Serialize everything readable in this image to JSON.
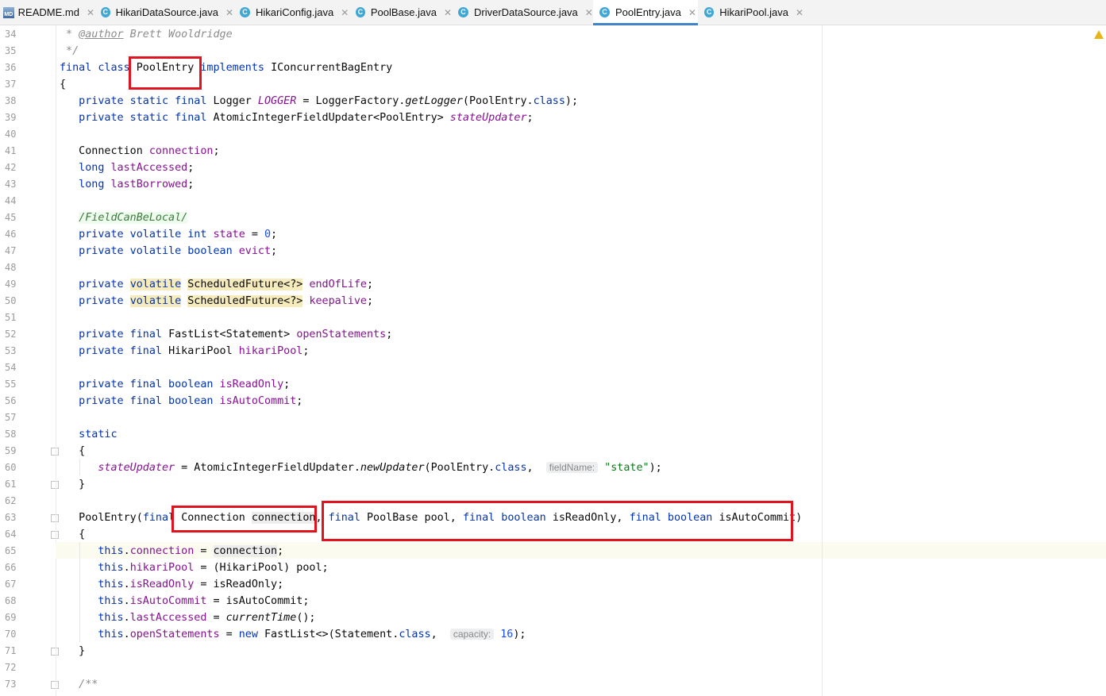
{
  "tabs": [
    {
      "label": "README.md",
      "icon": "markdown-file-icon",
      "icon_text": "MD",
      "active": false
    },
    {
      "label": "HikariDataSource.java",
      "icon": "java-class-icon",
      "icon_text": "C",
      "active": false
    },
    {
      "label": "HikariConfig.java",
      "icon": "java-class-icon",
      "icon_text": "C",
      "active": false
    },
    {
      "label": "PoolBase.java",
      "icon": "java-abstract-class-icon",
      "icon_text": "C",
      "active": false
    },
    {
      "label": "DriverDataSource.java",
      "icon": "java-class-icon",
      "icon_text": "C",
      "active": false
    },
    {
      "label": "PoolEntry.java",
      "icon": "java-class-icon",
      "icon_text": "C",
      "active": true
    },
    {
      "label": "HikariPool.java",
      "icon": "java-class-icon",
      "icon_text": "C",
      "active": false
    }
  ],
  "tab_close_glyph": "✕",
  "colors": {
    "keyword": "#0033b3",
    "field": "#871094",
    "number": "#1750eb",
    "string": "#067d17",
    "comment": "#8c8c8c",
    "annotation_box": "#e0141e",
    "active_tab_underline": "#4083c9"
  },
  "editor": {
    "line_numbers": [
      "34",
      "35",
      "36",
      "37",
      "38",
      "39",
      "40",
      "41",
      "42",
      "43",
      "44",
      "45",
      "46",
      "47",
      "48",
      "49",
      "50",
      "51",
      "52",
      "53",
      "54",
      "55",
      "56",
      "57",
      "58",
      "59",
      "60",
      "61",
      "62",
      "63",
      "64",
      "65",
      "66",
      "67",
      "68",
      "69",
      "70",
      "71",
      "72",
      "73"
    ],
    "current_line": "65",
    "lines": [
      [
        {
          "t": " * ",
          "c": "cmt"
        },
        {
          "t": "@author",
          "c": "tag"
        },
        {
          "t": " Brett Wooldridge",
          "c": "cmt"
        }
      ],
      [
        {
          "t": " */",
          "c": "cmt"
        }
      ],
      [
        {
          "t": "final class ",
          "c": "kw"
        },
        {
          "t": "PoolEntry ",
          "c": ""
        },
        {
          "t": "implements ",
          "c": "kw"
        },
        {
          "t": "IConcurrentBagEntry",
          "c": ""
        }
      ],
      [
        {
          "t": "{",
          "c": ""
        }
      ],
      [
        {
          "t": "   private static final ",
          "c": "kw"
        },
        {
          "t": "Logger ",
          "c": ""
        },
        {
          "t": "LOGGER",
          "c": "ifld"
        },
        {
          "t": " = LoggerFactory.",
          "c": ""
        },
        {
          "t": "getLogger",
          "c": "it"
        },
        {
          "t": "(PoolEntry.",
          "c": ""
        },
        {
          "t": "class",
          "c": "kw"
        },
        {
          "t": ");",
          "c": ""
        }
      ],
      [
        {
          "t": "   private static final ",
          "c": "kw"
        },
        {
          "t": "AtomicIntegerFieldUpdater<PoolEntry> ",
          "c": ""
        },
        {
          "t": "stateUpdater",
          "c": "ifld"
        },
        {
          "t": ";",
          "c": ""
        }
      ],
      [],
      [
        {
          "t": "   Connection ",
          "c": ""
        },
        {
          "t": "connection",
          "c": "fld"
        },
        {
          "t": ";",
          "c": ""
        }
      ],
      [
        {
          "t": "   long ",
          "c": "kw"
        },
        {
          "t": "lastAccessed",
          "c": "fld"
        },
        {
          "t": ";",
          "c": ""
        }
      ],
      [
        {
          "t": "   long ",
          "c": "kw"
        },
        {
          "t": "lastBorrowed",
          "c": "fld"
        },
        {
          "t": ";",
          "c": ""
        }
      ],
      [],
      [
        {
          "t": "   ",
          "c": ""
        },
        {
          "t": "/FieldCanBeLocal/",
          "c": "supp"
        }
      ],
      [
        {
          "t": "   private volatile int ",
          "c": "kw"
        },
        {
          "t": "state",
          "c": "fld"
        },
        {
          "t": " = ",
          "c": ""
        },
        {
          "t": "0",
          "c": "num"
        },
        {
          "t": ";",
          "c": ""
        }
      ],
      [
        {
          "t": "   private volatile boolean ",
          "c": "kw"
        },
        {
          "t": "evict",
          "c": "fld"
        },
        {
          "t": ";",
          "c": ""
        }
      ],
      [],
      [
        {
          "t": "   private ",
          "c": "kw"
        },
        {
          "t": "volatile",
          "c": "kw hl"
        },
        {
          "t": " ",
          "c": ""
        },
        {
          "t": "ScheduledFuture<?>",
          "c": "hl"
        },
        {
          "t": " ",
          "c": ""
        },
        {
          "t": "endOfLife",
          "c": "fld"
        },
        {
          "t": ";",
          "c": ""
        }
      ],
      [
        {
          "t": "   private ",
          "c": "kw"
        },
        {
          "t": "volatile",
          "c": "kw hl"
        },
        {
          "t": " ",
          "c": ""
        },
        {
          "t": "ScheduledFuture<?>",
          "c": "hl"
        },
        {
          "t": " ",
          "c": ""
        },
        {
          "t": "keepalive",
          "c": "fld"
        },
        {
          "t": ";",
          "c": ""
        }
      ],
      [],
      [
        {
          "t": "   private final ",
          "c": "kw"
        },
        {
          "t": "FastList<Statement> ",
          "c": ""
        },
        {
          "t": "openStatements",
          "c": "fld"
        },
        {
          "t": ";",
          "c": ""
        }
      ],
      [
        {
          "t": "   private final ",
          "c": "kw"
        },
        {
          "t": "HikariPool ",
          "c": ""
        },
        {
          "t": "hikariPool",
          "c": "fld"
        },
        {
          "t": ";",
          "c": ""
        }
      ],
      [],
      [
        {
          "t": "   private final boolean ",
          "c": "kw"
        },
        {
          "t": "isReadOnly",
          "c": "fld"
        },
        {
          "t": ";",
          "c": ""
        }
      ],
      [
        {
          "t": "   private final boolean ",
          "c": "kw"
        },
        {
          "t": "isAutoCommit",
          "c": "fld"
        },
        {
          "t": ";",
          "c": ""
        }
      ],
      [],
      [
        {
          "t": "   static",
          "c": "kw"
        }
      ],
      [
        {
          "t": "   {",
          "c": ""
        }
      ],
      [
        {
          "t": "      ",
          "c": ""
        },
        {
          "t": "stateUpdater",
          "c": "ifld"
        },
        {
          "t": " = AtomicIntegerFieldUpdater.",
          "c": ""
        },
        {
          "t": "newUpdater",
          "c": "it"
        },
        {
          "t": "(PoolEntry.",
          "c": ""
        },
        {
          "t": "class",
          "c": "kw"
        },
        {
          "t": ",  ",
          "c": ""
        },
        {
          "t": "fieldName:",
          "c": "hint"
        },
        {
          "t": " ",
          "c": ""
        },
        {
          "t": "\"state\"",
          "c": "str"
        },
        {
          "t": ");",
          "c": ""
        }
      ],
      [
        {
          "t": "   }",
          "c": ""
        }
      ],
      [],
      [
        {
          "t": "   PoolEntry(",
          "c": ""
        },
        {
          "t": "final ",
          "c": "kw"
        },
        {
          "t": "Connection ",
          "c": ""
        },
        {
          "t": "connection",
          "c": "ref"
        },
        {
          "t": ", ",
          "c": ""
        },
        {
          "t": "final ",
          "c": "kw"
        },
        {
          "t": "PoolBase pool, ",
          "c": ""
        },
        {
          "t": "final boolean ",
          "c": "kw"
        },
        {
          "t": "isReadOnly, ",
          "c": ""
        },
        {
          "t": "final boolean ",
          "c": "kw"
        },
        {
          "t": "isAutoCommit)",
          "c": ""
        }
      ],
      [
        {
          "t": "   {",
          "c": ""
        }
      ],
      [
        {
          "t": "      ",
          "c": ""
        },
        {
          "t": "this",
          "c": "kw"
        },
        {
          "t": ".",
          "c": ""
        },
        {
          "t": "connection",
          "c": "fld"
        },
        {
          "t": " = ",
          "c": ""
        },
        {
          "t": "connection",
          "c": "ref"
        },
        {
          "t": ";",
          "c": ""
        }
      ],
      [
        {
          "t": "      ",
          "c": ""
        },
        {
          "t": "this",
          "c": "kw"
        },
        {
          "t": ".",
          "c": ""
        },
        {
          "t": "hikariPool",
          "c": "fld"
        },
        {
          "t": " = (HikariPool) pool;",
          "c": ""
        }
      ],
      [
        {
          "t": "      ",
          "c": ""
        },
        {
          "t": "this",
          "c": "kw"
        },
        {
          "t": ".",
          "c": ""
        },
        {
          "t": "isReadOnly",
          "c": "fld"
        },
        {
          "t": " = isReadOnly;",
          "c": ""
        }
      ],
      [
        {
          "t": "      ",
          "c": ""
        },
        {
          "t": "this",
          "c": "kw"
        },
        {
          "t": ".",
          "c": ""
        },
        {
          "t": "isAutoCommit",
          "c": "fld"
        },
        {
          "t": " = isAutoCommit;",
          "c": ""
        }
      ],
      [
        {
          "t": "      ",
          "c": ""
        },
        {
          "t": "this",
          "c": "kw"
        },
        {
          "t": ".",
          "c": ""
        },
        {
          "t": "lastAccessed",
          "c": "fld"
        },
        {
          "t": " = ",
          "c": ""
        },
        {
          "t": "currentTime",
          "c": "it"
        },
        {
          "t": "();",
          "c": ""
        }
      ],
      [
        {
          "t": "      ",
          "c": ""
        },
        {
          "t": "this",
          "c": "kw"
        },
        {
          "t": ".",
          "c": ""
        },
        {
          "t": "openStatements",
          "c": "fld"
        },
        {
          "t": " = ",
          "c": ""
        },
        {
          "t": "new ",
          "c": "kw"
        },
        {
          "t": "FastList<>(Statement.",
          "c": ""
        },
        {
          "t": "class",
          "c": "kw"
        },
        {
          "t": ",  ",
          "c": ""
        },
        {
          "t": "capacity:",
          "c": "hint"
        },
        {
          "t": " ",
          "c": ""
        },
        {
          "t": "16",
          "c": "num"
        },
        {
          "t": ");",
          "c": ""
        }
      ],
      [
        {
          "t": "   }",
          "c": ""
        }
      ],
      [],
      [
        {
          "t": "   /**",
          "c": "cmt"
        }
      ]
    ]
  }
}
